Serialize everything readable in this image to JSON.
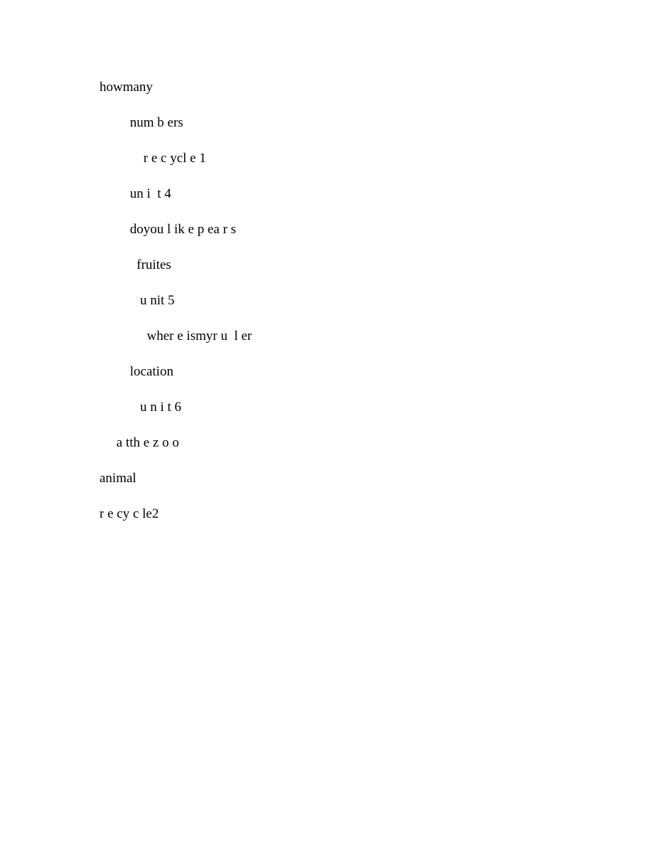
{
  "lines": [
    {
      "indent": 0,
      "text": "howmany"
    },
    {
      "indent": 9,
      "text": "num b ers"
    },
    {
      "indent": 13,
      "text": "r e c ycl e 1"
    },
    {
      "indent": 9,
      "text": "un i  t 4"
    },
    {
      "indent": 9,
      "text": "doyou l ik e p ea r s"
    },
    {
      "indent": 11,
      "text": "fruites"
    },
    {
      "indent": 12,
      "text": "u nit 5"
    },
    {
      "indent": 14,
      "text": "wher e ismyr u  l er"
    },
    {
      "indent": 9,
      "text": "location"
    },
    {
      "indent": 12,
      "text": "u n i t 6"
    },
    {
      "indent": 5,
      "text": "a tth e z o o"
    },
    {
      "indent": 0,
      "text": "animal"
    },
    {
      "indent": 0,
      "text": "r e cy c le2"
    }
  ]
}
